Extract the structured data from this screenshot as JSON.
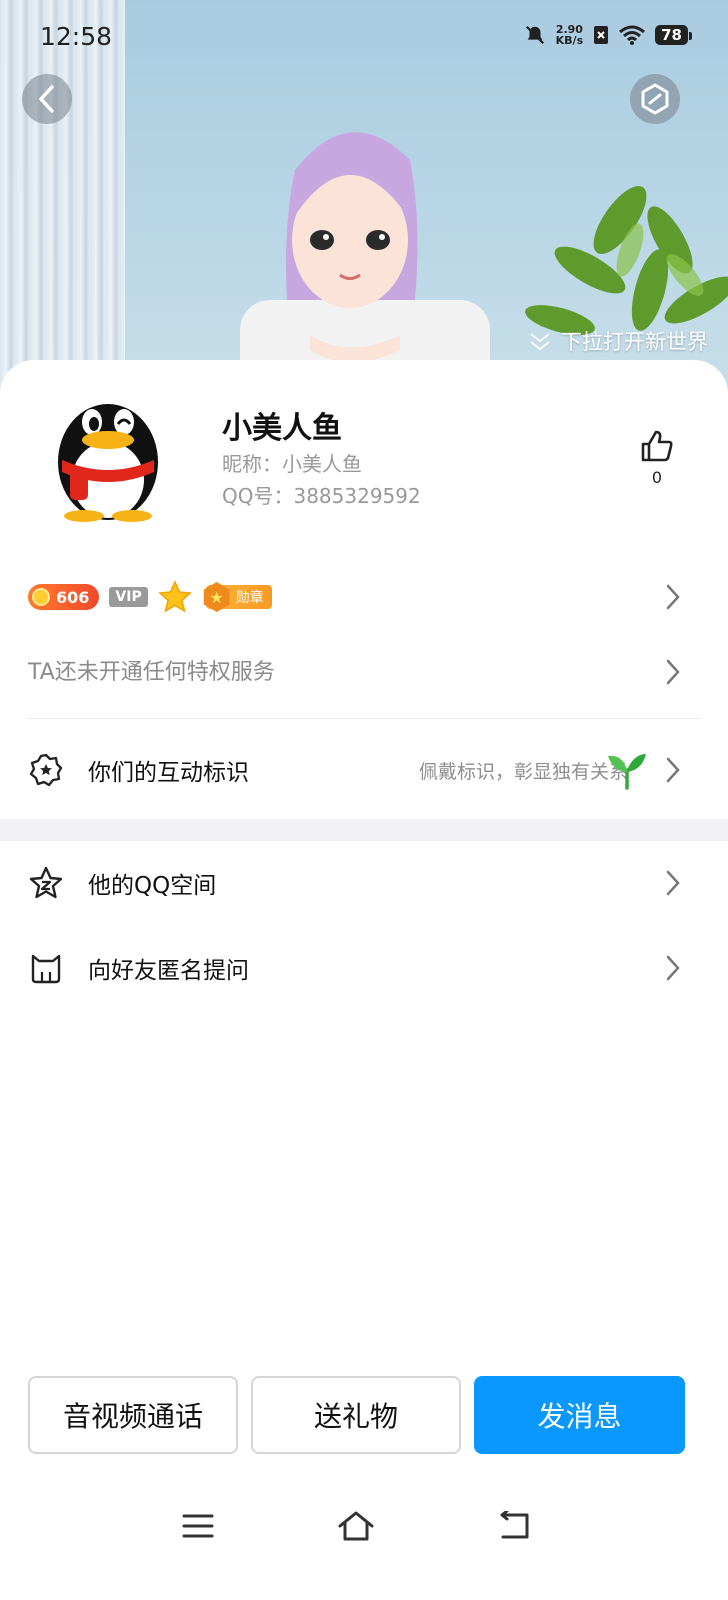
{
  "status_bar": {
    "time": "12:58",
    "net_speed_value": "2.90",
    "net_speed_unit": "KB/s",
    "battery": "78"
  },
  "hero": {
    "pull_hint": "下拉打开新世界"
  },
  "profile": {
    "name": "小美人鱼",
    "nickname": "昵称：小美人鱼",
    "qq_number": "QQ号：3885329592",
    "like_count": "0"
  },
  "badges": {
    "coin_level": "606",
    "vip_label": "VIP",
    "medal_label": "勋章"
  },
  "privilege_row": {
    "label": "TA还未开通任何特权服务"
  },
  "interaction_row": {
    "label": "你们的互动标识",
    "hint": "佩戴标识，彰显独有关系"
  },
  "links": [
    {
      "label": "他的QQ空间"
    },
    {
      "label": "向好友匿名提问"
    }
  ],
  "actions": {
    "call": "音视频通话",
    "gift": "送礼物",
    "message": "发消息"
  },
  "colors": {
    "primary": "#0a98ff",
    "coin_badge": "#f24a2b",
    "medal_badge": "#f79a22"
  }
}
